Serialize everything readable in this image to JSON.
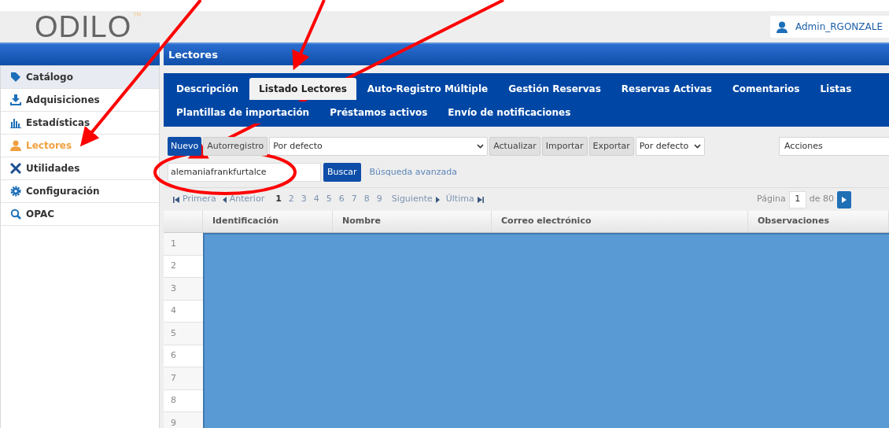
{
  "header": {
    "logo": "ODILO",
    "logo_tm": "TM",
    "user": "Admin_RGONZALE"
  },
  "sidebar": {
    "items": [
      {
        "label": "Catálogo",
        "selected": false,
        "highlighted": true
      },
      {
        "label": "Adquisiciones",
        "selected": false,
        "highlighted": false
      },
      {
        "label": "Estadísticas",
        "selected": false,
        "highlighted": false
      },
      {
        "label": "Lectores",
        "selected": true,
        "highlighted": false
      },
      {
        "label": "Utilidades",
        "selected": false,
        "highlighted": false
      },
      {
        "label": "Configuración",
        "selected": false,
        "highlighted": false
      },
      {
        "label": "OPAC",
        "selected": false,
        "highlighted": false
      }
    ]
  },
  "page_title": "Lectores",
  "tab_rows": [
    [
      {
        "label": "Descripción",
        "selected": false
      },
      {
        "label": "Listado Lectores",
        "selected": true
      },
      {
        "label": "Auto-Registro Múltiple",
        "selected": false
      },
      {
        "label": "Gestión Reservas",
        "selected": false
      },
      {
        "label": "Reservas Activas",
        "selected": false
      },
      {
        "label": "Comentarios",
        "selected": false
      },
      {
        "label": "Listas",
        "selected": false
      }
    ],
    [
      {
        "label": "Plantillas de importación",
        "selected": false
      },
      {
        "label": "Préstamos activos",
        "selected": false
      },
      {
        "label": "Envío de notificaciones",
        "selected": false
      }
    ]
  ],
  "toolbar": [
    {
      "kind": "primary",
      "label": "Nuevo"
    },
    {
      "kind": "button",
      "label": "Autorregistro"
    },
    {
      "kind": "select_wide",
      "label": "Por defecto"
    },
    {
      "kind": "button",
      "label": "Actualizar"
    },
    {
      "kind": "button",
      "label": "Importar"
    },
    {
      "kind": "button",
      "label": "Exportar"
    },
    {
      "kind": "select",
      "label": "Por defecto"
    },
    {
      "kind": "actions",
      "label": "Acciones"
    }
  ],
  "search": {
    "value": "alemaniafrankfurtalce",
    "button": "Buscar",
    "link": "Búsqueda avanzada"
  },
  "pagination": {
    "first": "Primera",
    "prev": "Anterior",
    "pages": [
      {
        "label": "1",
        "selected": true
      },
      {
        "label": "2",
        "selected": false
      },
      {
        "label": "3",
        "selected": false
      },
      {
        "label": "4",
        "selected": false
      },
      {
        "label": "5",
        "selected": false
      },
      {
        "label": "6",
        "selected": false
      },
      {
        "label": "7",
        "selected": false
      },
      {
        "label": "8",
        "selected": false
      },
      {
        "label": "9",
        "selected": false
      }
    ],
    "next": "Siguiente",
    "last": "Última",
    "page_label": "Página",
    "page_value": "1",
    "page_total": "de 80"
  },
  "table": {
    "columns": [
      "Identificación",
      "Nombre",
      "Correo electrónico",
      "Observaciones"
    ],
    "row_numbers": [
      "1",
      "2",
      "3",
      "4",
      "5",
      "6",
      "7",
      "8",
      "9"
    ]
  }
}
